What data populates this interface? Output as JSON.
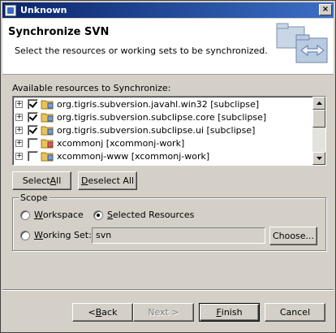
{
  "window": {
    "title": "Unknown",
    "close_label": "×"
  },
  "banner": {
    "title": "Synchronize SVN",
    "description": "Select the resources or working sets to be synchronized."
  },
  "resources": {
    "label": "Available resources to Synchronize:",
    "items": [
      {
        "label": "org.tigris.subversion.javahl.win32 [subclipse]",
        "checked": true
      },
      {
        "label": "org.tigris.subversion.subclipse.core [subclipse]",
        "checked": true
      },
      {
        "label": "org.tigris.subversion.subclipse.ui [subclipse]",
        "checked": true
      },
      {
        "label": "xcommonj [xcommonj-work]",
        "checked": false
      },
      {
        "label": "xcommonj-www [xcommonj-work]",
        "checked": false
      }
    ]
  },
  "selection_buttons": {
    "select_all_prefix": "Select ",
    "select_all_mnemonic": "A",
    "select_all_suffix": "ll",
    "deselect_all_mnemonic": "D",
    "deselect_all_suffix": "eselect All"
  },
  "scope": {
    "title": "Scope",
    "workspace_mnemonic": "W",
    "workspace_suffix": "orkspace",
    "selected_prefix": "S",
    "selected_suffix": "elected Resources",
    "working_set_mnemonic": "W",
    "working_set_suffix": "orking Set:",
    "working_set_value": "svn",
    "choose_label": "Choose...",
    "selected_option": "selected_resources"
  },
  "footer": {
    "back_prefix": "< ",
    "back_mnemonic": "B",
    "back_suffix": "ack",
    "next_label": "Next >",
    "finish_mnemonic": "F",
    "finish_suffix": "inish",
    "cancel_label": "Cancel"
  },
  "colors": {
    "titlebar_start": "#0a246a",
    "titlebar_end": "#3b6fc5",
    "dialog_bg": "#d4d0c8"
  }
}
